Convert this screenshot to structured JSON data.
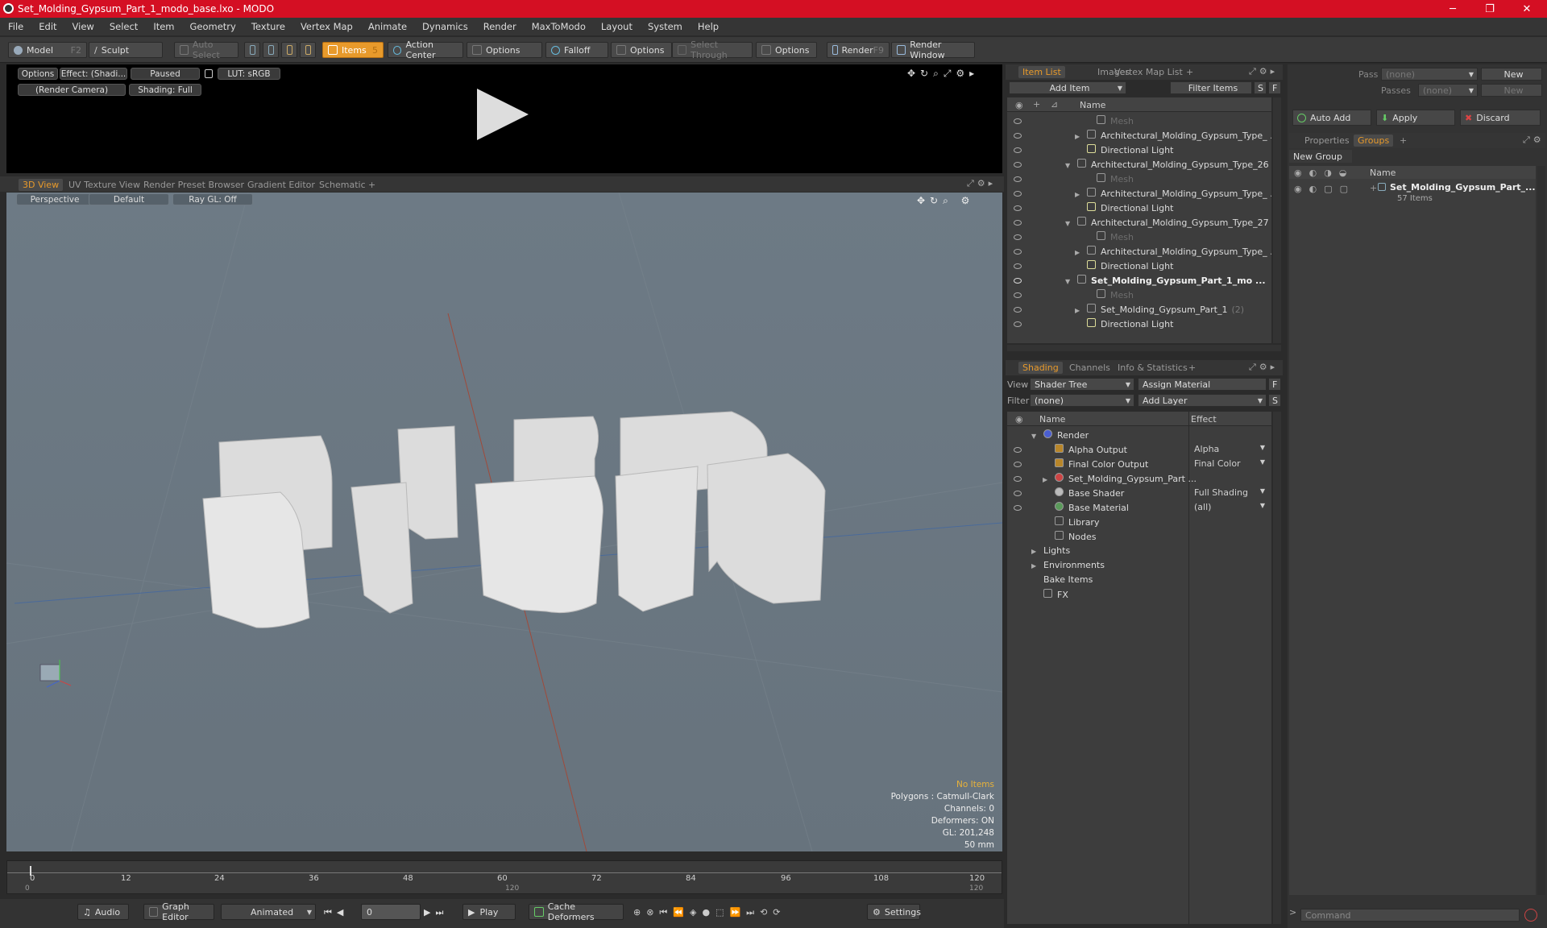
{
  "window": {
    "title": "Set_Molding_Gypsum_Part_1_modo_base.lxo - MODO",
    "minimize": "─",
    "maximize": "❐",
    "close": "✕"
  },
  "menu": [
    "File",
    "Edit",
    "View",
    "Select",
    "Item",
    "Geometry",
    "Texture",
    "Vertex Map",
    "Animate",
    "Dynamics",
    "Render",
    "MaxToModo",
    "Layout",
    "System",
    "Help"
  ],
  "toolbar": {
    "model": "Model",
    "model_key": "F2",
    "sculpt": "Sculpt",
    "auto_select": "Auto Select",
    "items": "Items",
    "items_key": "5",
    "action_center": "Action Center",
    "options1": "Options",
    "falloff": "Falloff",
    "options2": "Options",
    "select_through": "Select Through",
    "options3": "Options",
    "render": "Render",
    "render_key": "F9",
    "render_window": "Render Window"
  },
  "preview": {
    "options": "Options",
    "effect": "Effect: (Shadi...",
    "paused": "Paused",
    "lut": "LUT: sRGB",
    "camera": "(Render Camera)",
    "shading": "Shading: Full"
  },
  "viewport_tabs": [
    "3D View",
    "UV Texture View",
    "Render Preset Browser",
    "Gradient Editor",
    "Schematic",
    "+"
  ],
  "viewport": {
    "perspective": "Perspective",
    "default": "Default",
    "raygl": "Ray GL: Off"
  },
  "stats": {
    "no_items": "No Items",
    "polygons": "Polygons : Catmull-Clark",
    "channels": "Channels: 0",
    "deformers": "Deformers: ON",
    "gl": "GL: 201,248",
    "mm": "50 mm"
  },
  "timeline": {
    "ticks": [
      "0",
      "12",
      "24",
      "36",
      "48",
      "60",
      "72",
      "84",
      "96",
      "108",
      "120"
    ],
    "start": "0",
    "end": "120",
    "mid": "120"
  },
  "bottom": {
    "audio": "Audio",
    "graph_editor": "Graph Editor",
    "animated": "Animated",
    "frame": "0",
    "play": "Play",
    "cache": "Cache Deformers",
    "settings": "Settings"
  },
  "item_list": {
    "tabs": [
      "Item List",
      "Images",
      "Vertex Map List",
      "+"
    ],
    "add_item": "Add Item",
    "filter": "Filter Items",
    "s": "S",
    "f": "F",
    "col_name": "Name",
    "rows": [
      {
        "label": "Mesh",
        "indent": 3,
        "dim": true,
        "tri": ""
      },
      {
        "label": "Architectural_Molding_Gypsum_Type_ ...",
        "indent": 2,
        "dim": false,
        "tri": "▶"
      },
      {
        "label": "Directional Light",
        "indent": 2,
        "dim": false,
        "tri": ""
      },
      {
        "label": "Architectural_Molding_Gypsum_Type_26 ...",
        "indent": 1,
        "dim": false,
        "tri": "▼"
      },
      {
        "label": "Mesh",
        "indent": 3,
        "dim": true,
        "tri": ""
      },
      {
        "label": "Architectural_Molding_Gypsum_Type_ ...",
        "indent": 2,
        "dim": false,
        "tri": "▶"
      },
      {
        "label": "Directional Light",
        "indent": 2,
        "dim": false,
        "tri": ""
      },
      {
        "label": "Architectural_Molding_Gypsum_Type_27 ...",
        "indent": 1,
        "dim": false,
        "tri": "▼"
      },
      {
        "label": "Mesh",
        "indent": 3,
        "dim": true,
        "tri": ""
      },
      {
        "label": "Architectural_Molding_Gypsum_Type_ ...",
        "indent": 2,
        "dim": false,
        "tri": "▶"
      },
      {
        "label": "Directional Light",
        "indent": 2,
        "dim": false,
        "tri": ""
      },
      {
        "label": "Set_Molding_Gypsum_Part_1_mo ...",
        "indent": 1,
        "dim": false,
        "tri": "▼",
        "bold": true
      },
      {
        "label": "Mesh",
        "indent": 3,
        "dim": true,
        "tri": ""
      },
      {
        "label": "Set_Molding_Gypsum_Part_1",
        "indent": 2,
        "dim": false,
        "tri": "▶",
        "suffix": "(2)"
      },
      {
        "label": "Directional Light",
        "indent": 2,
        "dim": false,
        "tri": ""
      }
    ]
  },
  "shading": {
    "tabs": [
      "Shading",
      "Channels",
      "Info & Statistics",
      "+"
    ],
    "view_label": "View",
    "view_value": "Shader Tree",
    "assign_material": "Assign Material",
    "f": "F",
    "filter_label": "Filter",
    "filter_value": "(none)",
    "add_layer": "Add Layer",
    "s": "S",
    "col_name": "Name",
    "col_effect": "Effect",
    "rows": [
      {
        "label": "Render",
        "effect": "",
        "indent": 0,
        "tri": "▼",
        "eye": false
      },
      {
        "label": "Alpha Output",
        "effect": "Alpha",
        "indent": 1,
        "tri": "",
        "eye": true
      },
      {
        "label": "Final Color Output",
        "effect": "Final Color",
        "indent": 1,
        "tri": "",
        "eye": true
      },
      {
        "label": "Set_Molding_Gypsum_Part ...",
        "effect": "",
        "indent": 1,
        "tri": "▶",
        "eye": true
      },
      {
        "label": "Base Shader",
        "effect": "Full Shading",
        "indent": 1,
        "tri": "",
        "eye": true
      },
      {
        "label": "Base Material",
        "effect": "(all)",
        "indent": 1,
        "tri": "",
        "eye": true
      },
      {
        "label": "Library",
        "effect": "",
        "indent": 1,
        "tri": "",
        "eye": false
      },
      {
        "label": "Nodes",
        "effect": "",
        "indent": 1,
        "tri": "",
        "eye": false
      },
      {
        "label": "Lights",
        "effect": "",
        "indent": 0,
        "tri": "▶",
        "eye": false
      },
      {
        "label": "Environments",
        "effect": "",
        "indent": 0,
        "tri": "▶",
        "eye": false
      },
      {
        "label": "Bake Items",
        "effect": "",
        "indent": 0,
        "tri": "",
        "eye": false
      },
      {
        "label": "FX",
        "effect": "",
        "indent": 0,
        "tri": "",
        "eye": false
      }
    ]
  },
  "right": {
    "pass_groups": "Pass Groups",
    "pass_groups_value": "(none)",
    "new": "New",
    "passes": "Passes",
    "passes_value": "(none)",
    "new2": "New",
    "auto_add": "Auto Add",
    "apply": "Apply",
    "discard": "Discard",
    "tabs": [
      "Properties",
      "Groups",
      "+"
    ],
    "new_group": "New Group",
    "col_name": "Name",
    "group_name": "Set_Molding_Gypsum_Part_...",
    "group_count": "57 Items",
    "command": "Command"
  },
  "colors": {
    "accent": "#e89a2b",
    "title_bar": "#d40f23"
  }
}
